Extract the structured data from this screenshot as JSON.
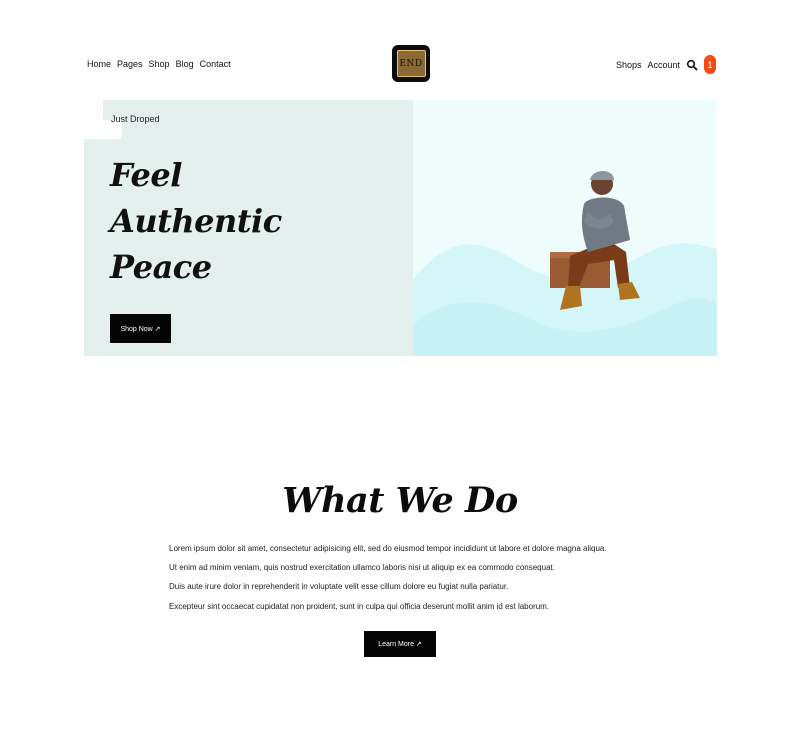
{
  "header": {
    "nav_left": [
      "Home",
      "Pages",
      "Shop",
      "Blog",
      "Contact"
    ],
    "logo_text": "END",
    "nav_right": [
      "Shops",
      "Account"
    ],
    "search_icon": "search-icon",
    "cart_count": "1",
    "cart_color": "#f04e12"
  },
  "hero": {
    "eyebrow": "Just Droped",
    "headline_lines": [
      "Feel",
      "Authentic",
      "Peace"
    ],
    "button_label": "Shop Now ↗",
    "bg_left": "#e4f0ee",
    "bg_right": "#eefcfc"
  },
  "what_we_do": {
    "title": "What We Do",
    "paragraphs": [
      "Lorem ipsum dolor sit amet, consectetur adipisicing elit, sed do eiusmod tempor incididunt ut labore et dolore magna aliqua.",
      "Ut enim ad minim veniam, quis nostrud exercitation ullamco laboris nisi ut aliquip ex ea commodo consequat.",
      "Duis aute irure dolor in reprehenderit in voluptate velit esse cillum dolore eu fugiat nulla pariatur.",
      "Excepteur sint occaecat cupidatat non proident, sunt in culpa qui officia deserunt mollit anim id est laborum."
    ],
    "button_label": "Learn More ↗"
  }
}
